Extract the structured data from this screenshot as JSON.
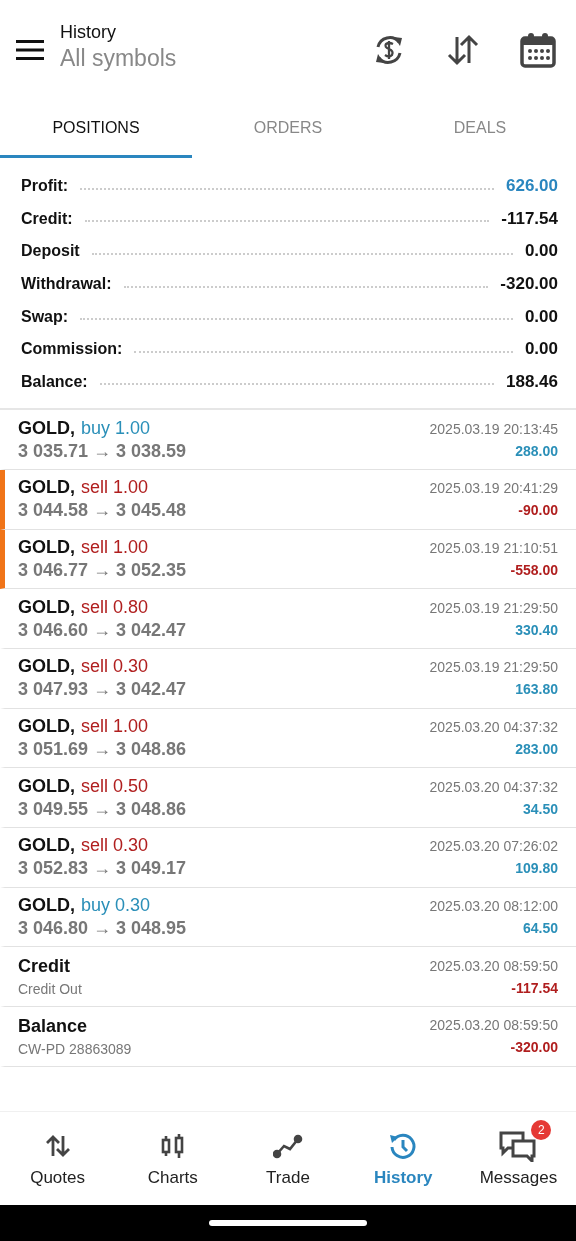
{
  "header": {
    "title": "History",
    "subtitle": "All symbols"
  },
  "tabs": [
    {
      "label": "POSITIONS",
      "selected": true
    },
    {
      "label": "ORDERS",
      "selected": false
    },
    {
      "label": "DEALS",
      "selected": false
    }
  ],
  "summary": [
    {
      "label": "Profit:",
      "value": "626.00",
      "highlight": true
    },
    {
      "label": "Credit:",
      "value": "-117.54",
      "highlight": false
    },
    {
      "label": "Deposit",
      "value": "0.00",
      "highlight": false
    },
    {
      "label": "Withdrawal:",
      "value": "-320.00",
      "highlight": false
    },
    {
      "label": "Swap:",
      "value": "0.00",
      "highlight": false
    },
    {
      "label": "Commission:",
      "value": "0.00",
      "highlight": false
    },
    {
      "label": "Balance:",
      "value": "188.46",
      "highlight": false
    }
  ],
  "rows": [
    {
      "kind": "trade",
      "symbol": "GOLD,",
      "is_sell": false,
      "action": "buy 1.00",
      "prices": "3 035.71 → 3 038.59",
      "time": "2025.03.19 20:13:45",
      "profit": "288.00",
      "negative": false,
      "marked": false
    },
    {
      "kind": "trade",
      "symbol": "GOLD,",
      "is_sell": true,
      "action": "sell 1.00",
      "prices": "3 044.58 → 3 045.48",
      "time": "2025.03.19 20:41:29",
      "profit": "-90.00",
      "negative": true,
      "marked": true
    },
    {
      "kind": "trade",
      "symbol": "GOLD,",
      "is_sell": true,
      "action": "sell 1.00",
      "prices": "3 046.77 → 3 052.35",
      "time": "2025.03.19 21:10:51",
      "profit": "-558.00",
      "negative": true,
      "marked": true
    },
    {
      "kind": "trade",
      "symbol": "GOLD,",
      "is_sell": true,
      "action": "sell 0.80",
      "prices": "3 046.60 → 3 042.47",
      "time": "2025.03.19 21:29:50",
      "profit": "330.40",
      "negative": false,
      "marked": false
    },
    {
      "kind": "trade",
      "symbol": "GOLD,",
      "is_sell": true,
      "action": "sell 0.30",
      "prices": "3 047.93 → 3 042.47",
      "time": "2025.03.19 21:29:50",
      "profit": "163.80",
      "negative": false,
      "marked": false
    },
    {
      "kind": "trade",
      "symbol": "GOLD,",
      "is_sell": true,
      "action": "sell 1.00",
      "prices": "3 051.69 → 3 048.86",
      "time": "2025.03.20 04:37:32",
      "profit": "283.00",
      "negative": false,
      "marked": false
    },
    {
      "kind": "trade",
      "symbol": "GOLD,",
      "is_sell": true,
      "action": "sell 0.50",
      "prices": "3 049.55 → 3 048.86",
      "time": "2025.03.20 04:37:32",
      "profit": "34.50",
      "negative": false,
      "marked": false
    },
    {
      "kind": "trade",
      "symbol": "GOLD,",
      "is_sell": true,
      "action": "sell 0.30",
      "prices": "3 052.83 → 3 049.17",
      "time": "2025.03.20 07:26:02",
      "profit": "109.80",
      "negative": false,
      "marked": false
    },
    {
      "kind": "trade",
      "symbol": "GOLD,",
      "is_sell": false,
      "action": "buy 0.30",
      "prices": "3 046.80 → 3 048.95",
      "time": "2025.03.20 08:12:00",
      "profit": "64.50",
      "negative": false,
      "marked": false
    },
    {
      "kind": "operation",
      "symbol": "Credit",
      "prices": "Credit Out",
      "time": "2025.03.20 08:59:50",
      "profit": "-117.54",
      "negative": true,
      "marked": false
    },
    {
      "kind": "operation",
      "symbol": "Balance",
      "prices": "CW-PD 28863089",
      "time": "2025.03.20 08:59:50",
      "profit": "-320.00",
      "negative": true,
      "marked": false
    }
  ],
  "nav": [
    {
      "kind": "quotes",
      "label": "Quotes",
      "selected": false
    },
    {
      "kind": "charts",
      "label": "Charts",
      "selected": false
    },
    {
      "kind": "trade",
      "label": "Trade",
      "selected": false
    },
    {
      "kind": "history",
      "label": "History",
      "selected": true
    },
    {
      "kind": "messages",
      "label": "Messages",
      "selected": false,
      "badge": "2"
    }
  ]
}
